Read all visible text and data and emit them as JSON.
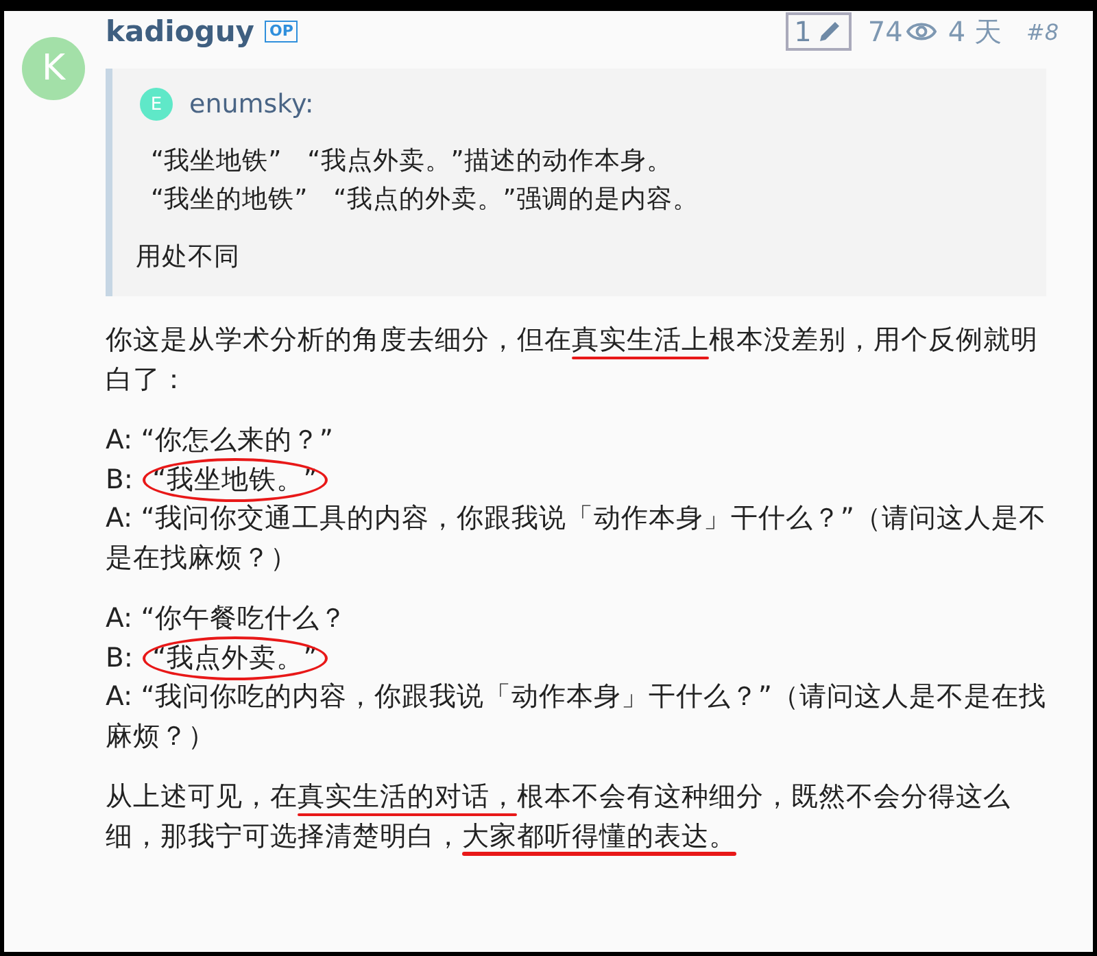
{
  "post": {
    "avatar_letter": "K",
    "username": "kadioguy",
    "badge": "OP",
    "edits": "1",
    "views": "74",
    "age": "4 天",
    "number": "#8"
  },
  "quote": {
    "avatar_letter": "E",
    "author": "enumsky:",
    "paragraphs": [
      [
        "“我坐地铁”　“我点外卖。”描述的动作本身。",
        "“我坐的地铁”　“我点的外卖。”强调的是内容。"
      ],
      [
        "用处不同"
      ]
    ]
  },
  "body": [
    [
      [
        {
          "kind": "plain",
          "text": "你这是从学术分析的角度去细分，但在"
        },
        {
          "kind": "underline",
          "text": "真实生活上"
        },
        {
          "kind": "plain",
          "text": "根本没差别，用个反例就明白了："
        }
      ]
    ],
    [
      [
        {
          "kind": "plain",
          "text": "A: “你怎么来的？”"
        }
      ],
      [
        {
          "kind": "plain",
          "text": "B: "
        },
        {
          "kind": "circle",
          "text": "“我坐地铁。”"
        }
      ],
      [
        {
          "kind": "plain",
          "text": "A: “我问你交通工具的内容，你跟我说「动作本身」干什么？”（请问这人是不是在找麻烦？）"
        }
      ]
    ],
    [
      [
        {
          "kind": "plain",
          "text": "A: “你午餐吃什么？"
        }
      ],
      [
        {
          "kind": "plain",
          "text": "B: "
        },
        {
          "kind": "circle",
          "text": "“我点外卖。”"
        }
      ],
      [
        {
          "kind": "plain",
          "text": "A: “我问你吃的内容，你跟我说「动作本身」干什么？”（请问这人是不是在找麻烦？）"
        }
      ]
    ],
    [
      [
        {
          "kind": "plain",
          "text": "从上述可见，在"
        },
        {
          "kind": "underline",
          "text": "真实生活的对话，"
        },
        {
          "kind": "plain",
          "text": "根本不会有这种细分，既然不会分得这么细，那我宁可选择清楚明白，"
        },
        {
          "kind": "underline",
          "text": "大家都听得懂的表达。"
        }
      ]
    ]
  ]
}
